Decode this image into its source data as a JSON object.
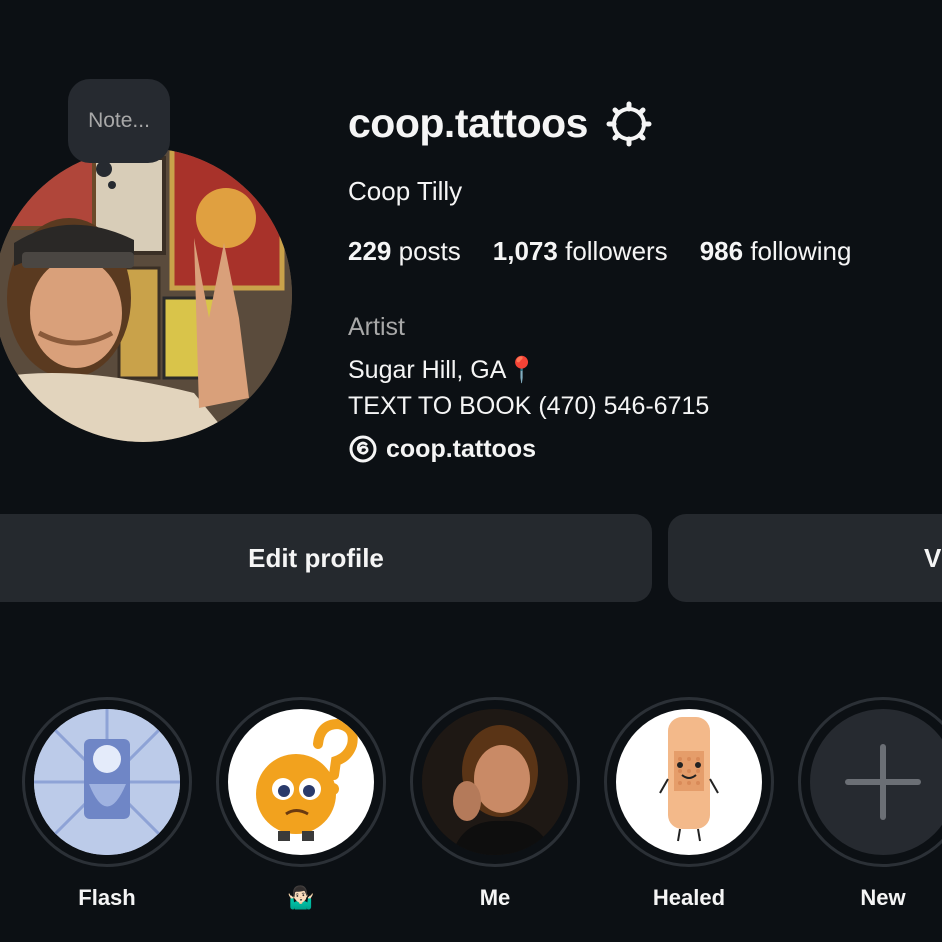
{
  "profile": {
    "username": "coop.tattoos",
    "full_name": "Coop Tilly",
    "note_placeholder": "Note...",
    "stats": [
      {
        "count": "229",
        "label": "posts"
      },
      {
        "count": "1,073",
        "label": "followers"
      },
      {
        "count": "986",
        "label": "following"
      }
    ],
    "category": "Artist",
    "bio": {
      "location": "Sugar Hill, GA📍",
      "booking": "TEXT TO BOOK (470) 546-6715"
    },
    "threads_handle": "coop.tattoos"
  },
  "actions": {
    "edit_profile_label": "Edit profile",
    "view_archive_label": "V"
  },
  "highlights": [
    {
      "label": "Flash",
      "thumb": "flash-art"
    },
    {
      "label": "🤷🏻‍♂️",
      "thumb": "confused-emoji"
    },
    {
      "label": "Me",
      "thumb": "portrait"
    },
    {
      "label": "Healed",
      "thumb": "bandage"
    },
    {
      "label": "New",
      "thumb": "plus-icon"
    }
  ],
  "colors": {
    "background": "#0c1014",
    "button": "#25292e",
    "secondary_text": "#a8a8a8"
  }
}
